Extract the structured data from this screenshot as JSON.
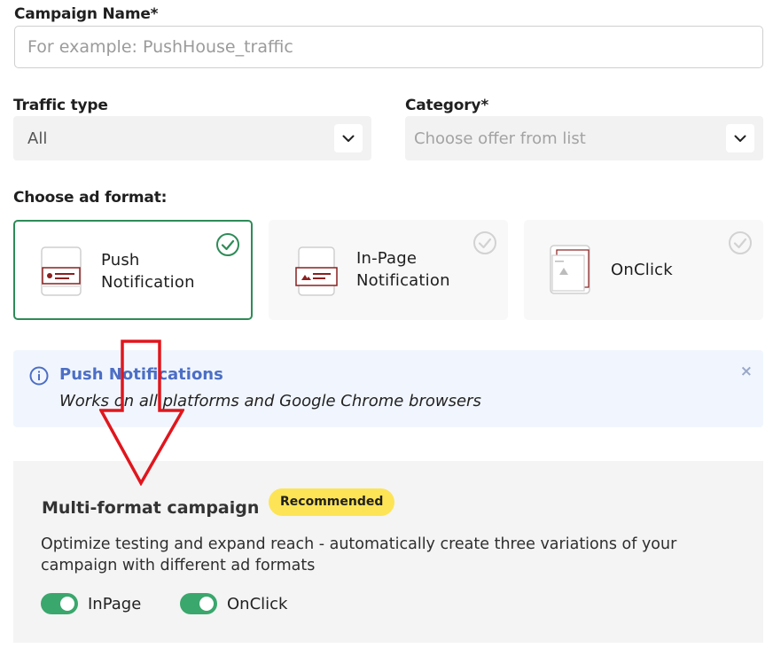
{
  "campaign_name": {
    "label": "Campaign Name*",
    "placeholder": "For example: PushHouse_traffic",
    "value": ""
  },
  "traffic_type": {
    "label": "Traffic type",
    "value": "All"
  },
  "category": {
    "label": "Category*",
    "placeholder": "Choose offer from list"
  },
  "ad_format": {
    "label": "Choose ad format:",
    "options": [
      {
        "label_line1": "Push",
        "label_line2": "Notification",
        "selected": true
      },
      {
        "label_line1": "In-Page",
        "label_line2": "Notification",
        "selected": false
      },
      {
        "label_line1": "OnClick",
        "label_line2": "",
        "selected": false
      }
    ]
  },
  "info_box": {
    "title": "Push Notifications",
    "text": "Works on all platforms and Google Chrome browsers",
    "close_symbol": "×"
  },
  "multi_format": {
    "title": "Multi-format campaign",
    "badge": "Recommended",
    "description": "Optimize testing and expand reach - automatically create three variations of your campaign with different ad formats",
    "toggles": [
      {
        "label": "InPage",
        "on": true
      },
      {
        "label": "OnClick",
        "on": true
      }
    ]
  },
  "colors": {
    "selected_border": "#2e8b57",
    "info_title": "#4c6ec5",
    "badge": "#fde456",
    "toggle_on": "#3aa76d",
    "annotation_arrow": "#e0161d",
    "illustration_accent": "#8b1f1f"
  }
}
